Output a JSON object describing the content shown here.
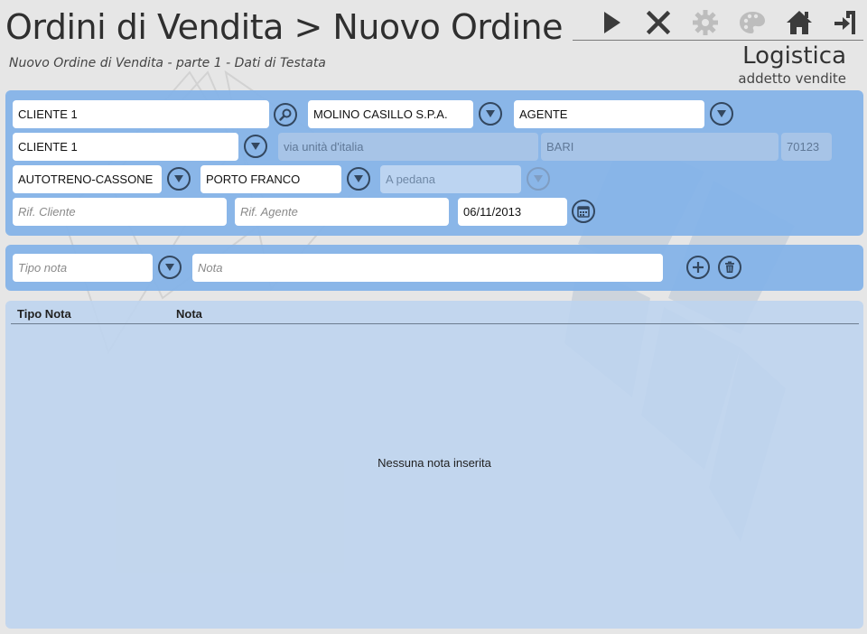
{
  "header": {
    "title": "Ordini di Vendita > Nuovo Ordine",
    "subtitle": "Nuovo Ordine di Vendita - parte 1 - Dati di Testata",
    "area": "Logistica",
    "role": "addetto vendite"
  },
  "toolbar": {
    "icons": [
      "play-icon",
      "close-icon",
      "gear-icon",
      "palette-icon",
      "home-icon",
      "exit-icon"
    ]
  },
  "order_form": {
    "cliente_code": "CLIENTE 1",
    "cliente_name": "MOLINO CASILLO S.P.A.",
    "agente": "AGENTE",
    "destinazione": "CLIENTE 1",
    "indirizzo": "via unità d'italia",
    "citta": "BARI",
    "cap": "70123",
    "trasporto": "AUTOTRENO-CASSONE",
    "porto": "PORTO FRANCO",
    "imballo_placeholder": "A pedana",
    "rif_cliente_placeholder": "Rif. Cliente",
    "rif_agente_placeholder": "Rif. Agente",
    "data": "06/11/2013"
  },
  "note_form": {
    "tipo_placeholder": "Tipo nota",
    "nota_placeholder": "Nota"
  },
  "notes_grid": {
    "columns": [
      "Tipo Nota",
      "Nota"
    ],
    "empty_text": "Nessuna nota inserita"
  },
  "colors": {
    "background": "#e6e6e6",
    "panel": "#82b2e8",
    "grid_panel": "#bed4ee",
    "icon_dark": "#33475f",
    "icon_disabled": "#b8b8b8"
  }
}
